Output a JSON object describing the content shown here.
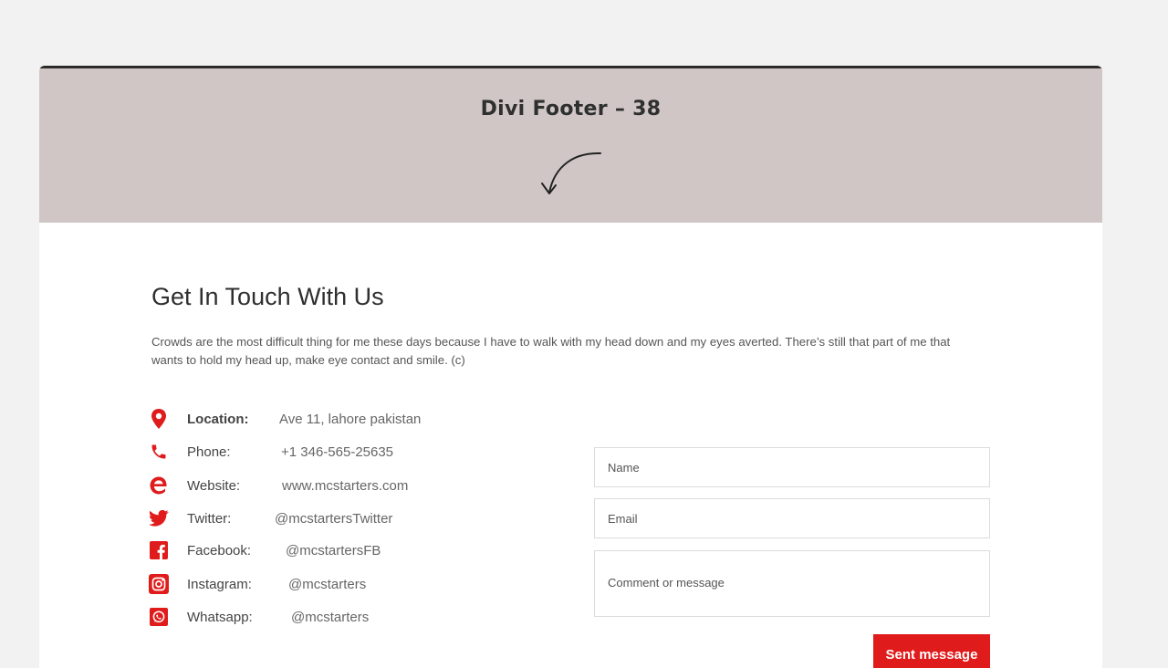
{
  "hero": {
    "title": "Divi Footer – 38"
  },
  "contact": {
    "title": "Get In Touch With Us",
    "intro": "Crowds are the most difficult thing for me these days because I have to walk with my head down and my eyes averted. There’s still that part of me that wants to hold my head up, make eye contact and smile. (c)"
  },
  "info": [
    {
      "icon": "location-pin-icon",
      "label": "Location:",
      "value": "Ave 11, lahore pakistan"
    },
    {
      "icon": "phone-icon",
      "label": "Phone:",
      "value": "+1 346-565-25635"
    },
    {
      "icon": "edge-browser-icon",
      "label": "Website:",
      "value": "www.mcstarters.com"
    },
    {
      "icon": "twitter-icon",
      "label": "Twitter:",
      "value": "@mcstartersTwitter"
    },
    {
      "icon": "facebook-icon",
      "label": "Facebook:",
      "value": "@mcstartersFB"
    },
    {
      "icon": "instagram-icon",
      "label": "Instagram:",
      "value": "@mcstarters"
    },
    {
      "icon": "whatsapp-icon",
      "label": "Whatsapp:",
      "value": "@mcstarters"
    }
  ],
  "form": {
    "name_placeholder": "Name",
    "email_placeholder": "Email",
    "message_placeholder": "Comment or message",
    "submit_label": "Sent message"
  },
  "colors": {
    "accent": "#e01b1b",
    "hero_bg": "#d0c6c6",
    "page_bg": "#f2f2f2"
  }
}
